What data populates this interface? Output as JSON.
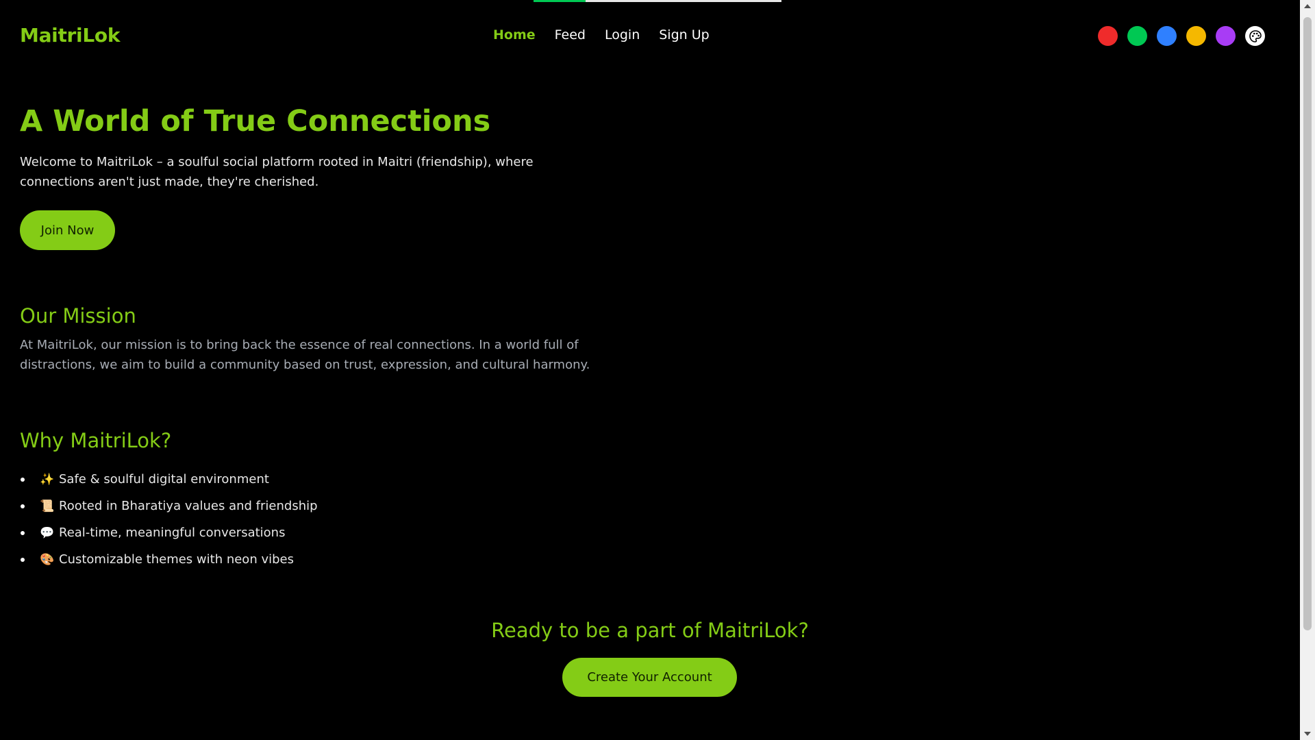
{
  "page": {
    "progress_percent": 21
  },
  "navbar": {
    "brand": "MaitriLok",
    "links": [
      {
        "label": "Home",
        "active": true
      },
      {
        "label": "Feed",
        "active": false
      },
      {
        "label": "Login",
        "active": false
      },
      {
        "label": "Sign Up",
        "active": false
      }
    ],
    "theme_colors": [
      {
        "name": "red",
        "hex": "#ef2b2b"
      },
      {
        "name": "green",
        "hex": "#00c853"
      },
      {
        "name": "blue",
        "hex": "#2f80ff"
      },
      {
        "name": "amber",
        "hex": "#f5b800"
      },
      {
        "name": "purple",
        "hex": "#a83cf5"
      }
    ],
    "palette_icon": "palette-icon"
  },
  "hero": {
    "title": "A World of True Connections",
    "text": "Welcome to MaitriLok – a soulful social platform rooted in Maitri (friendship), where connections aren't just made, they're cherished.",
    "button": "Join Now"
  },
  "mission": {
    "title": "Our Mission",
    "text": "At MaitriLok, our mission is to bring back the essence of real connections. In a world full of distractions, we aim to build a community based on trust, expression, and cultural harmony."
  },
  "why": {
    "title": "Why MaitriLok?",
    "items": [
      {
        "emoji": "✨",
        "text": "Safe & soulful digital environment"
      },
      {
        "emoji": "📜",
        "text": "Rooted in Bharatiya values and friendship"
      },
      {
        "emoji": "💬",
        "text": "Real-time, meaningful conversations"
      },
      {
        "emoji": "🎨",
        "text": "Customizable themes with neon vibes"
      }
    ]
  },
  "cta": {
    "title": "Ready to be a part of MaitriLok?",
    "button": "Create Your Account"
  },
  "colors": {
    "accent": "#84cc16",
    "background": "#000000"
  }
}
